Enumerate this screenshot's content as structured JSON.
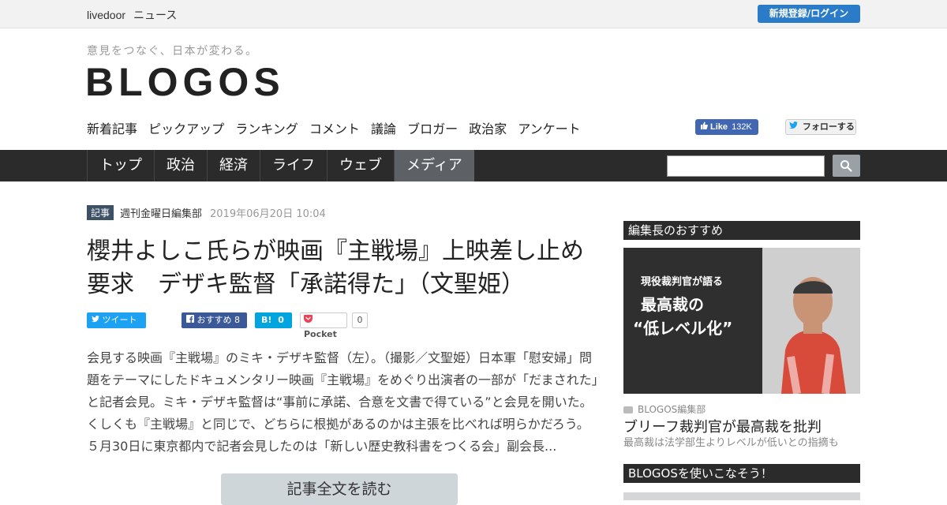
{
  "topbar": {
    "brand": "livedoor",
    "brand_sub": "ニュース",
    "login_label": "新規登録/ログイン"
  },
  "header": {
    "tagline": "意見をつなぐ、日本が変わる。",
    "logo": "BLOGOS",
    "subnav": [
      "新着記事",
      "ピックアップ",
      "ランキング",
      "コメント",
      "議論",
      "ブロガー",
      "政治家",
      "アンケート"
    ],
    "fb_like_label": "Like",
    "fb_like_count": "132K",
    "tw_follow_label": "フォローする"
  },
  "mainnav": {
    "items": [
      "トップ",
      "政治",
      "経済",
      "ライフ",
      "ウェブ",
      "メディア"
    ],
    "active": "メディア"
  },
  "search": {
    "placeholder": ""
  },
  "article": {
    "tag": "記事",
    "author": "週刊金曜日編集部",
    "date": "2019年06月20日 10:04",
    "title": "櫻井よしこ氏らが映画『主戦場』上映差し止め要求　デザキ監督「承諾得た」（文聖姫）",
    "share": {
      "tweet": "ツイート",
      "fb_recommend": "おすすめ",
      "fb_count": "8",
      "hatena_label": "B!",
      "hatena_count": "0",
      "pocket_label": "Pocket",
      "pocket_count": "0"
    },
    "summary": "会見する映画『主戦場』のミキ・デザキ監督（左）。（撮影／文聖姫）日本軍「慰安婦」問題をテーマにしたドキュメンタリー映画『主戦場』をめぐり出演者の一部が「だまされた」と記者会見。ミキ・デザキ監督は“事前に承諾、合意を文書で得ている”と会見を開いた。くしくも『主戦場』と同じで、どちらに根拠があるのかは主張を比べれば明らかだろう。５月30日に東京都内で記者会見したのは「新しい歴史教科書をつくる会」副会長...",
    "readmore": "記事全文を読む"
  },
  "sidebar": {
    "pick_heading": "編集長のおすすめ",
    "image_caption_line1": "現役裁判官が語る",
    "image_caption_line2": "最高裁の",
    "image_caption_line3": "“低レベル化”",
    "source": "BLOGOS編集部",
    "pick_title": "ブリーフ裁判官が最高裁を批判",
    "pick_desc": "最高裁は法学部生よりレベルが低いとの指摘も",
    "guide_heading": "BLOGOSを使いこなそう！"
  },
  "colors": {
    "nav_bg": "#2b2b2b",
    "nav_active": "#5d6166",
    "login_btn": "#2a7bc8",
    "article_tag": "#3d5166",
    "twitter": "#1da1f2",
    "facebook": "#3b5998",
    "hatena": "#00a4de"
  }
}
